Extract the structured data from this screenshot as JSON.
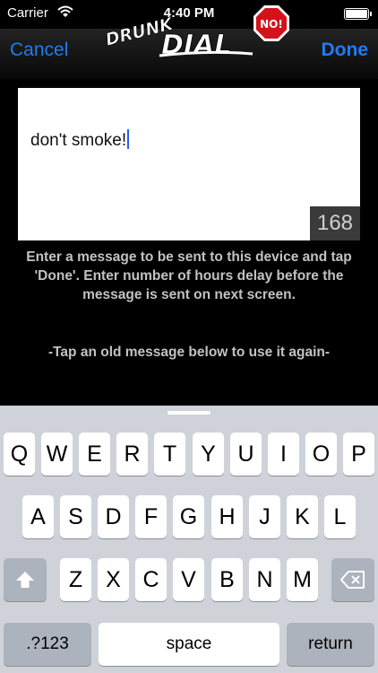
{
  "status_bar": {
    "carrier": "Carrier",
    "time": "4:40 PM"
  },
  "nav": {
    "cancel_label": "Cancel",
    "done_label": "Done",
    "logo_line1": "DRUNK",
    "logo_line2": "DIAL",
    "logo_sign": "NO!"
  },
  "message": {
    "text": "don't smoke!",
    "remaining_chars": "168"
  },
  "instructions": "Enter a message to be sent to this device and tap 'Done'. Enter number of hours delay before the message is sent on next screen.",
  "old_message_hint": "-Tap an old message below to use it again-",
  "keyboard": {
    "row1": [
      "Q",
      "W",
      "E",
      "R",
      "T",
      "Y",
      "U",
      "I",
      "O",
      "P"
    ],
    "row2": [
      "A",
      "S",
      "D",
      "F",
      "G",
      "H",
      "J",
      "K",
      "L"
    ],
    "row3": [
      "Z",
      "X",
      "C",
      "V",
      "B",
      "N",
      "M"
    ],
    "numbers_label": ".?123",
    "space_label": "space",
    "return_label": "return",
    "shift_icon": "shift-arrow",
    "delete_icon": "backspace"
  },
  "colors": {
    "accent": "#1f7cf3",
    "sign_red": "#d3121b"
  }
}
